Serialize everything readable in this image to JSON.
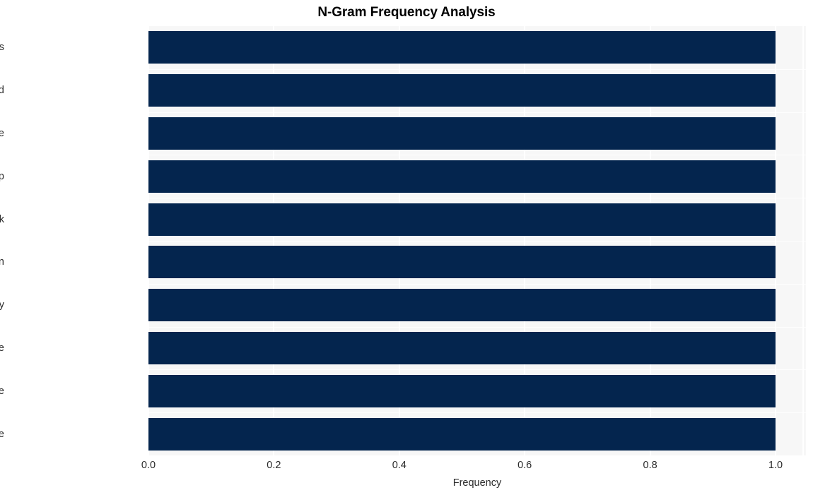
{
  "chart_data": {
    "type": "bar",
    "orientation": "horizontal",
    "title": "N-Gram Frequency Analysis",
    "xlabel": "Frequency",
    "ylabel": "",
    "xlim": [
      0.0,
      1.0
    ],
    "xticks": [
      "0.0",
      "0.2",
      "0.4",
      "0.6",
      "0.8",
      "1.0"
    ],
    "xtick_values": [
      0.0,
      0.2,
      0.4,
      0.6,
      0.8,
      1.0
    ],
    "grid": true,
    "legend": null,
    "bar_color": "#04254e",
    "plot_background": "#f7f7f7",
    "figure_background": "#ffffff",
    "categories": [
      "hash fbi agents",
      "fbi agents board",
      "agents board baltimore",
      "board baltimore ship",
      "baltimore ship link",
      "ship link singaporean",
      "link singaporean company",
      "singaporean company sue",
      "company sue bridge",
      "sue bridge collapse"
    ],
    "values": [
      1.0,
      1.0,
      1.0,
      1.0,
      1.0,
      1.0,
      1.0,
      1.0,
      1.0,
      1.0
    ]
  }
}
